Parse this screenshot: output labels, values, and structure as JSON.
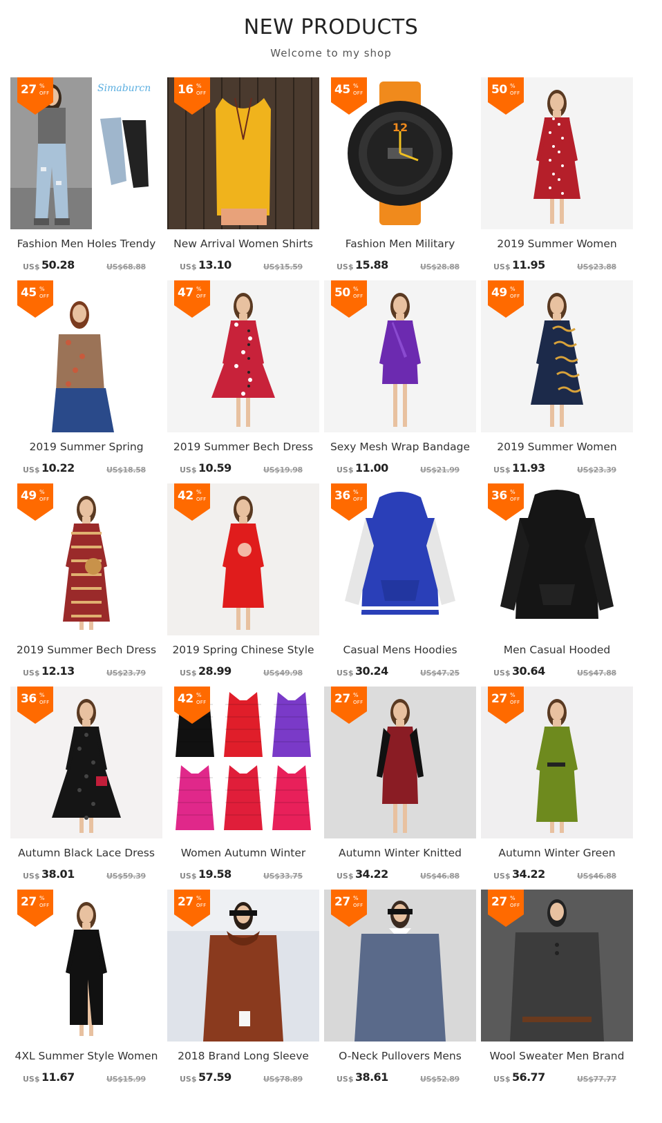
{
  "header": {
    "title": "NEW PRODUCTS",
    "subtitle": "Welcome to my shop"
  },
  "badge": {
    "percent_symbol": "%",
    "off_label": "OFF"
  },
  "currency": "US$",
  "brand_watermark": "Simaburcn",
  "colors": {
    "badge": "#ff6a00",
    "text": "#333333",
    "old_price": "#9a9a9a"
  },
  "products": [
    {
      "name": "Fashion Men Holes Trendy",
      "discount": "27",
      "price": "50.28",
      "old_price": "US$68.88",
      "image": "ripped-jeans"
    },
    {
      "name": "New Arrival Women Shirts",
      "discount": "16",
      "price": "13.10",
      "old_price": "US$15.59",
      "image": "yellow-tank-top"
    },
    {
      "name": "Fashion Men Military",
      "discount": "45",
      "price": "15.88",
      "old_price": "US$28.88",
      "image": "orange-sport-watch"
    },
    {
      "name": "2019 Summer Women",
      "discount": "50",
      "price": "11.95",
      "old_price": "US$23.88",
      "image": "red-polka-dot-dress"
    },
    {
      "name": "2019 Summer Spring",
      "discount": "45",
      "price": "10.22",
      "old_price": "US$18.58",
      "image": "mesh-blouse"
    },
    {
      "name": "2019 Summer Bech Dress",
      "discount": "47",
      "price": "10.59",
      "old_price": "US$19.98",
      "image": "red-floral-dress"
    },
    {
      "name": "Sexy Mesh Wrap Bandage",
      "discount": "50",
      "price": "11.00",
      "old_price": "US$21.99",
      "image": "purple-wrap-dress"
    },
    {
      "name": "2019 Summer Women",
      "discount": "49",
      "price": "11.93",
      "old_price": "US$23.39",
      "image": "navy-chain-print-dress"
    },
    {
      "name": "2019 Summer Bech Dress",
      "discount": "49",
      "price": "12.13",
      "old_price": "US$23.79",
      "image": "boho-maxi-dress"
    },
    {
      "name": "2019 Spring Chinese Style",
      "discount": "42",
      "price": "28.99",
      "old_price": "US$49.98",
      "image": "red-qipao-dress"
    },
    {
      "name": "Casual Mens Hoodies",
      "discount": "36",
      "price": "30.24",
      "old_price": "US$47.25",
      "image": "blue-white-hoodie"
    },
    {
      "name": "Men Casual Hooded",
      "discount": "36",
      "price": "30.64",
      "old_price": "US$47.88",
      "image": "black-hoodie"
    },
    {
      "name": "Autumn Black Lace Dress",
      "discount": "36",
      "price": "38.01",
      "old_price": "US$59.39",
      "image": "black-lace-dress"
    },
    {
      "name": "Women Autumn Winter",
      "discount": "42",
      "price": "19.58",
      "old_price": "US$33.75",
      "image": "padded-vests"
    },
    {
      "name": "Autumn Winter Knitted",
      "discount": "27",
      "price": "34.22",
      "old_price": "US$46.88",
      "image": "knitted-dress"
    },
    {
      "name": "Autumn Winter Green",
      "discount": "27",
      "price": "34.22",
      "old_price": "US$46.88",
      "image": "green-velvet-dress"
    },
    {
      "name": "4XL Summer Style Women",
      "discount": "27",
      "price": "11.67",
      "old_price": "US$15.99",
      "image": "black-slit-dress"
    },
    {
      "name": "2018 Brand Long Sleeve",
      "discount": "27",
      "price": "57.59",
      "old_price": "US$78.89",
      "image": "brown-hooded-sweater"
    },
    {
      "name": "O-Neck Pullovers Mens",
      "discount": "27",
      "price": "38.61",
      "old_price": "US$52.89",
      "image": "grey-pullover"
    },
    {
      "name": "Wool Sweater Men Brand",
      "discount": "27",
      "price": "56.77",
      "old_price": "US$77.77",
      "image": "charcoal-sweater"
    }
  ]
}
